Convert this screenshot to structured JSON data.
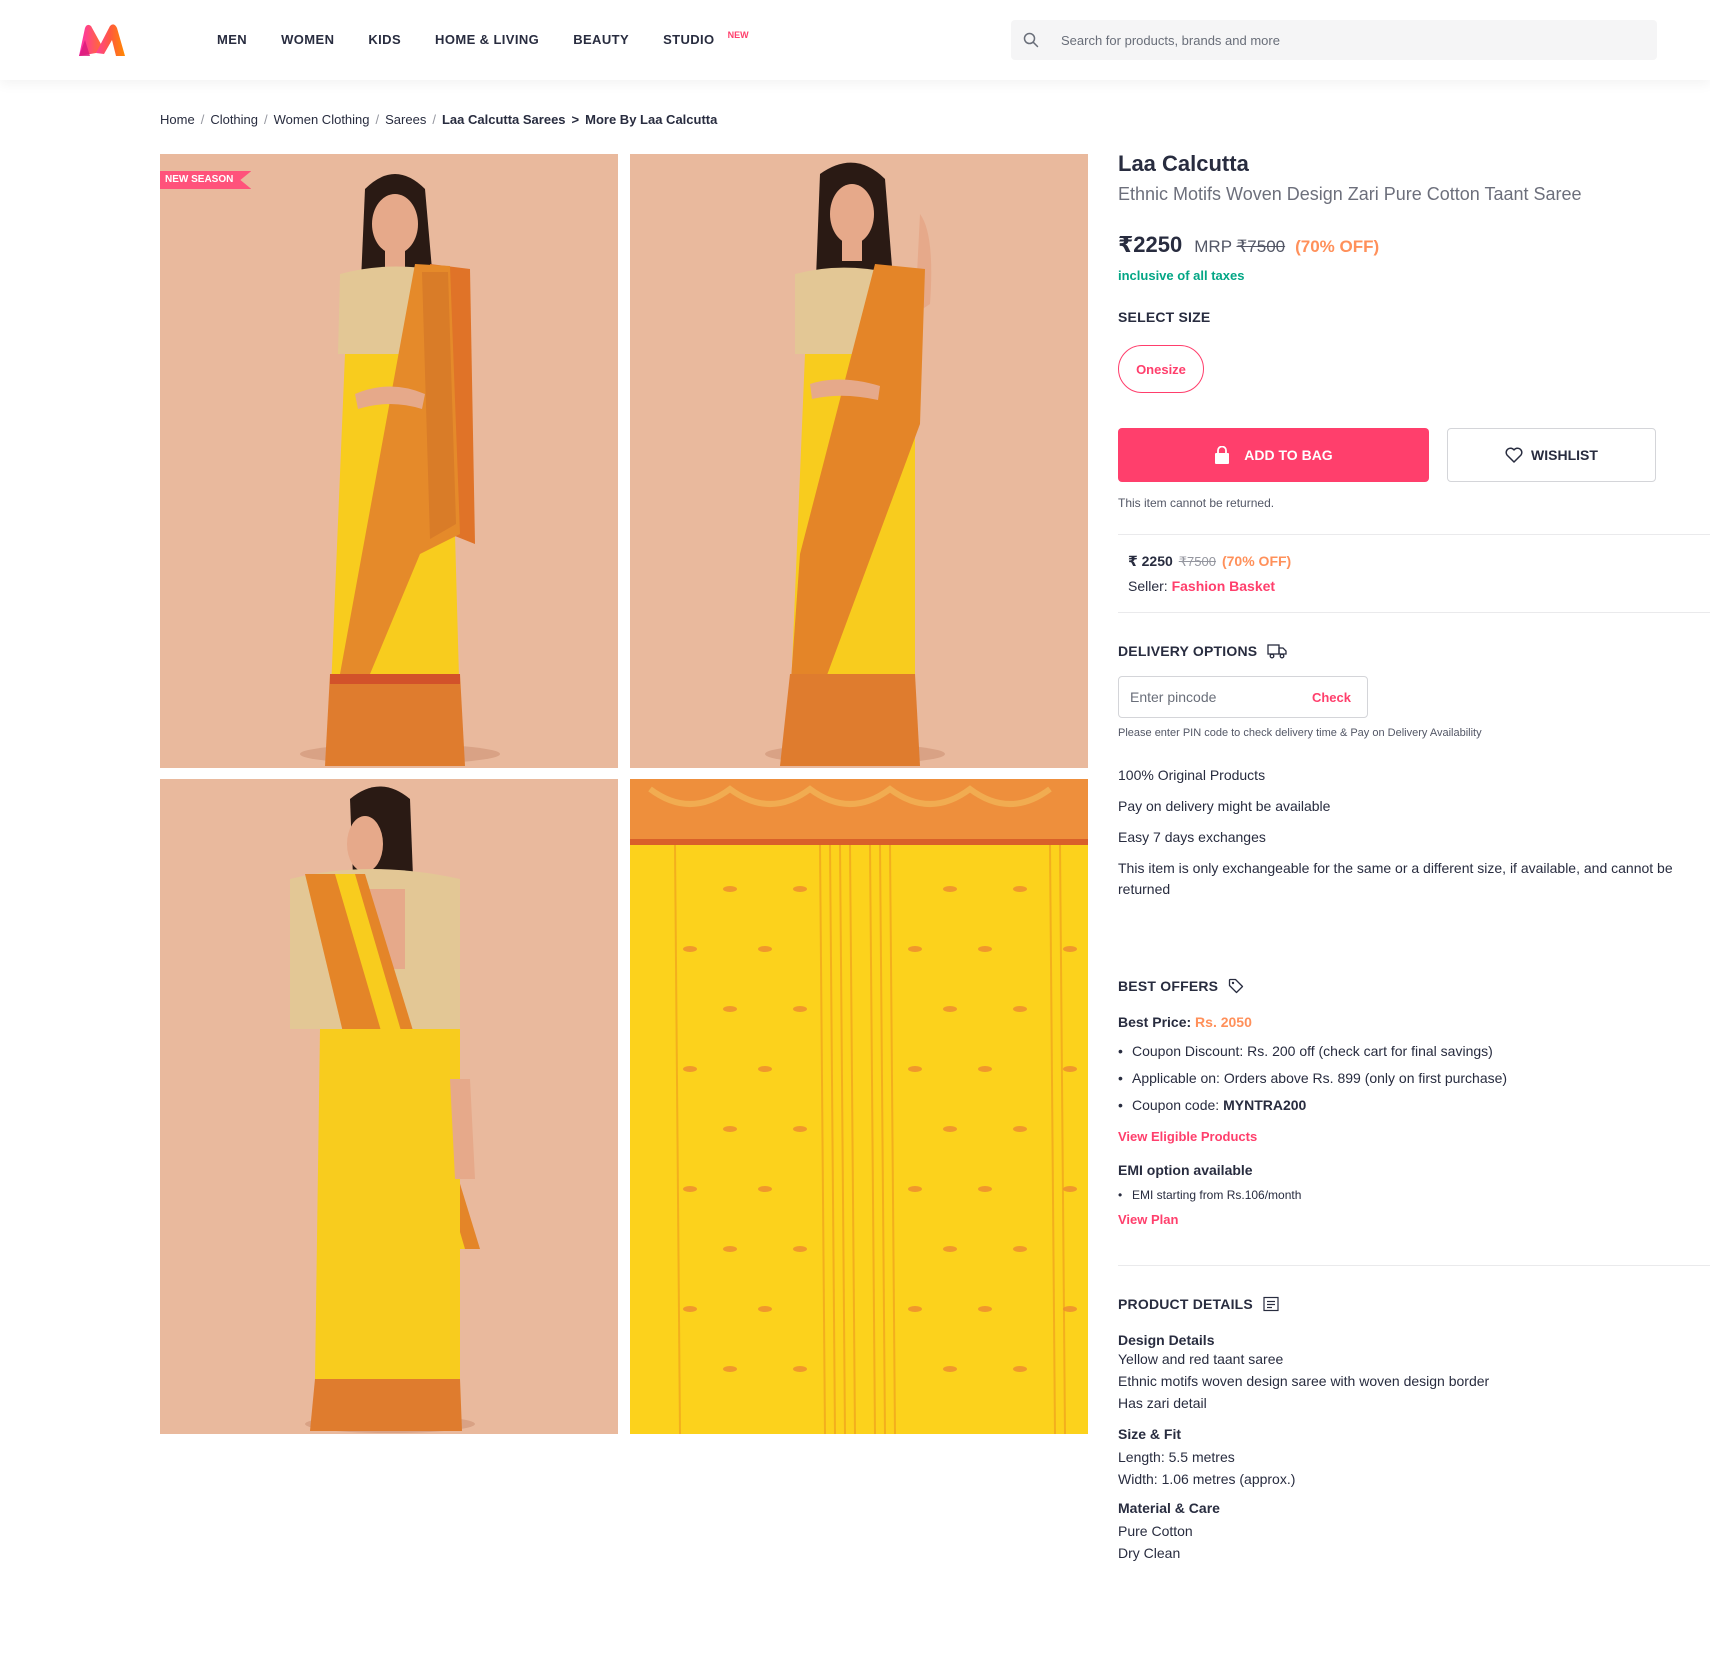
{
  "header": {
    "nav": [
      {
        "label": "MEN"
      },
      {
        "label": "WOMEN"
      },
      {
        "label": "KIDS"
      },
      {
        "label": "HOME & LIVING"
      },
      {
        "label": "BEAUTY"
      },
      {
        "label": "STUDIO",
        "tag": "NEW"
      }
    ],
    "search_placeholder": "Search for products, brands and more"
  },
  "breadcrumb": [
    "Home",
    "Clothing",
    "Women Clothing",
    "Sarees",
    "Laa Calcutta Sarees",
    "More By Laa Calcutta"
  ],
  "gallery": {
    "badge": "NEW SEASON"
  },
  "product": {
    "brand": "Laa Calcutta",
    "name": "Ethnic Motifs Woven Design Zari Pure Cotton Taant Saree",
    "price": "₹2250",
    "mrp_label": "MRP",
    "mrp": "₹7500",
    "discount": "(70% OFF)",
    "tax_note": "inclusive of all taxes",
    "select_size_label": "SELECT SIZE",
    "size": "Onesize",
    "add_to_bag": "ADD TO BAG",
    "wishlist": "WISHLIST",
    "return_note": "This item cannot be returned."
  },
  "seller": {
    "price": "₹ 2250",
    "mrp": "₹7500",
    "discount": "(70% OFF)",
    "label": "Seller:",
    "name": "Fashion Basket"
  },
  "delivery": {
    "title": "DELIVERY OPTIONS",
    "pincode_placeholder": "Enter pincode",
    "check": "Check",
    "note": "Please enter PIN code to check delivery time & Pay on Delivery Availability",
    "features": [
      "100% Original Products",
      "Pay on delivery might be available",
      "Easy 7 days exchanges",
      "This item is only exchangeable for the same or a different size, if available, and cannot be returned"
    ]
  },
  "offers": {
    "title": "BEST OFFERS",
    "best_price_label": "Best Price:",
    "best_price_value": "Rs. 2050",
    "items": [
      "Coupon Discount: Rs. 200 off (check cart for final savings)",
      "Applicable on: Orders above Rs. 899 (only on first purchase)"
    ],
    "coupon_label": "Coupon code:",
    "coupon_code": "MYNTRA200",
    "view_eligible": "View Eligible Products",
    "emi_title": "EMI option available",
    "emi_item": "EMI starting from Rs.106/month",
    "view_plan": "View Plan"
  },
  "details": {
    "title": "PRODUCT DETAILS",
    "design_title": "Design Details",
    "design_lines": [
      "Yellow and red taant saree",
      "Ethnic motifs woven design saree with woven design border",
      "Has zari detail"
    ],
    "size_title": "Size & Fit",
    "size_lines": [
      "Length: 5.5 metres",
      "Width: 1.06 metres (approx.)"
    ],
    "material_title": "Material & Care",
    "material_lines": [
      "Pure Cotton",
      "Dry Clean"
    ]
  },
  "colors": {
    "accent": "#ff3f6c",
    "discount": "#ff905a",
    "success": "#03a685",
    "text": "#282c3f"
  }
}
